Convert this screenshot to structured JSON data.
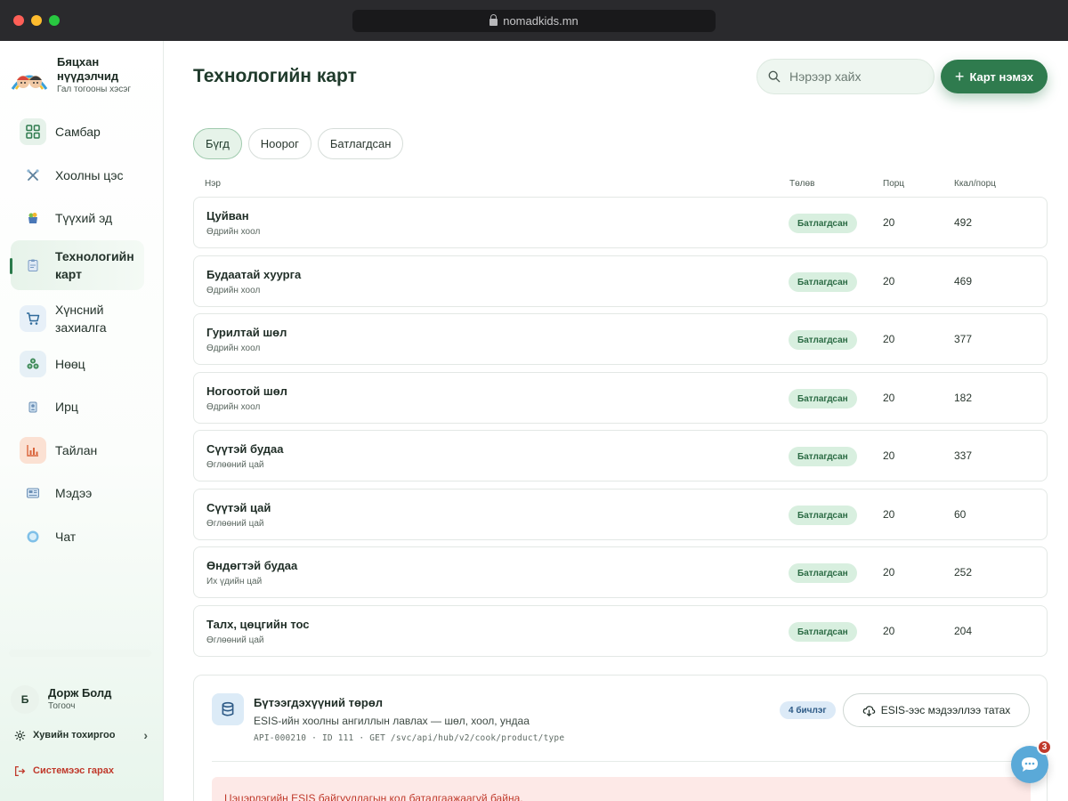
{
  "browser": {
    "url": "nomadkids.mn"
  },
  "brand": {
    "title": "Бяцхан нүүдэлчид",
    "subtitle": "Гал тогооны хэсэг"
  },
  "sidebar": {
    "items": [
      {
        "label": "Самбар",
        "icon": "dashboard-icon"
      },
      {
        "label": "Хоолны цэс",
        "icon": "utensils-icon"
      },
      {
        "label": "Түүхий эд",
        "icon": "ingredients-icon"
      },
      {
        "label": "Технологийн карт",
        "icon": "clipboard-icon",
        "active": true
      },
      {
        "label": "Хүнсний захиалга",
        "icon": "cart-icon"
      },
      {
        "label": "Нөөц",
        "icon": "stock-icon"
      },
      {
        "label": "Ирц",
        "icon": "attendance-icon"
      },
      {
        "label": "Тайлан",
        "icon": "chart-icon"
      },
      {
        "label": "Мэдээ",
        "icon": "news-icon"
      },
      {
        "label": "Чат",
        "icon": "chat-icon"
      }
    ]
  },
  "user": {
    "initial": "Б",
    "name": "Дорж Болд",
    "role": "Тогооч"
  },
  "settings_label": "Хувийн тохиргоо",
  "logout_label": "Системээс гарах",
  "page": {
    "title": "Технологийн карт"
  },
  "search": {
    "placeholder": "Нэрээр хайх"
  },
  "add_button": "Карт нэмэх",
  "filters": [
    {
      "label": "Бүгд",
      "active": true
    },
    {
      "label": "Ноорог",
      "active": false
    },
    {
      "label": "Батлагдсан",
      "active": false
    }
  ],
  "table": {
    "headers": {
      "name": "Нэр",
      "status": "Төлөв",
      "portion": "Порц",
      "kcal": "Ккал/порц"
    },
    "rows": [
      {
        "name": "Цуйван",
        "category": "Өдрийн хоол",
        "status": "Батлагдсан",
        "portion": "20",
        "kcal": "492"
      },
      {
        "name": "Будаатай хуурга",
        "category": "Өдрийн хоол",
        "status": "Батлагдсан",
        "portion": "20",
        "kcal": "469"
      },
      {
        "name": "Гурилтай шөл",
        "category": "Өдрийн хоол",
        "status": "Батлагдсан",
        "portion": "20",
        "kcal": "377"
      },
      {
        "name": "Ногоотой шөл",
        "category": "Өдрийн хоол",
        "status": "Батлагдсан",
        "portion": "20",
        "kcal": "182"
      },
      {
        "name": "Сүүтэй будаа",
        "category": "Өглөөний цай",
        "status": "Батлагдсан",
        "portion": "20",
        "kcal": "337"
      },
      {
        "name": "Сүүтэй цай",
        "category": "Өглөөний цай",
        "status": "Батлагдсан",
        "portion": "20",
        "kcal": "60"
      },
      {
        "name": "Өндөгтэй будаа",
        "category": "Их үдийн цай",
        "status": "Батлагдсан",
        "portion": "20",
        "kcal": "252"
      },
      {
        "name": "Талх, цөцгийн тос",
        "category": "Өглөөний цай",
        "status": "Батлагдсан",
        "portion": "20",
        "kcal": "204"
      }
    ]
  },
  "esis_panel": {
    "title": "Бүтээгдэхүүний төрөл",
    "description": "ESIS-ийн хоолны ангиллын лавлах — шөл, хоол, ундаа",
    "api": "API-000210 · ID 111 · GET /svc/api/hub/v2/cook/product/type",
    "doc_count": "4 бичлэг",
    "fetch_button": "ESIS-ээс мэдээллээ татах",
    "alert": "Цэцэрлэгийн ESIS байгууллагын код баталгаажаагүй байна."
  },
  "chat": {
    "unread": "3"
  },
  "colors": {
    "accent": "#2f7b4e",
    "badge_bg": "#d8efdf",
    "danger": "#c0392b"
  }
}
